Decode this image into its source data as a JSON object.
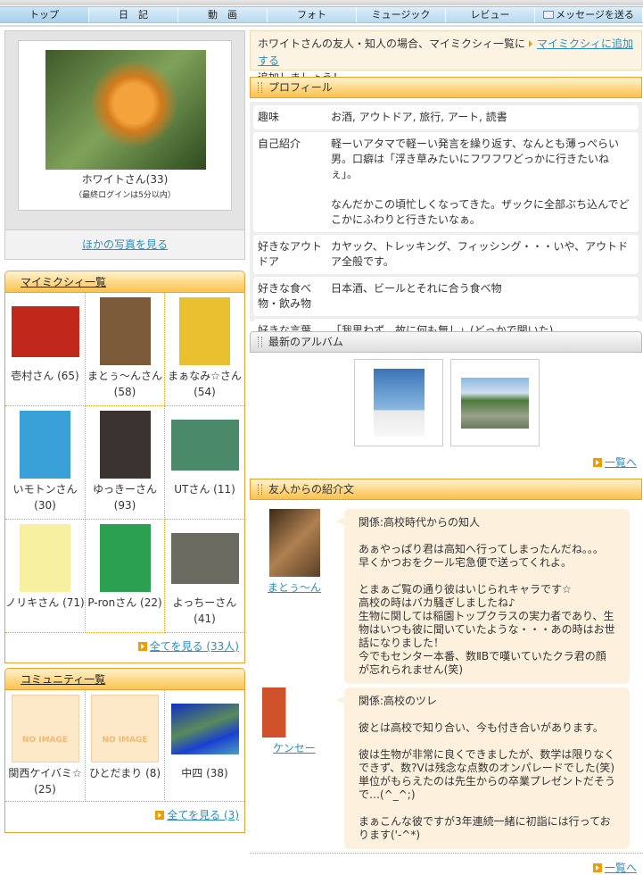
{
  "nav": {
    "items": [
      "トップ",
      "日　記",
      "動　画",
      "フォト",
      "ミュージック",
      "レビュー",
      "メッセージを送る"
    ]
  },
  "profile_card": {
    "name": "ホワイトさん(33)",
    "last_login": "（最終ログインは5分以内）",
    "other_photos": "ほかの写真を見る"
  },
  "mymixi": {
    "title": "マイミクシィ一覧",
    "friends": [
      {
        "name": "壱村さん (65)",
        "color": "#c0281c"
      },
      {
        "name": "まとぅ〜んさん (58)",
        "color": "#7a5a38"
      },
      {
        "name": "まぁなみ☆さん (54)",
        "color": "#e8c030"
      },
      {
        "name": "いモトンさん (30)",
        "color": "#3aa0d8"
      },
      {
        "name": "ゆっきーさん (93)",
        "color": "#3a3330"
      },
      {
        "name": "UTさん (11)",
        "color": "#4a8a6a"
      },
      {
        "name": "ノリキさん (71)",
        "color": "#f6f0a0"
      },
      {
        "name": "P-ronさん (22)",
        "color": "#2aa050"
      },
      {
        "name": "よっちーさん (41)",
        "color": "#6a6a60"
      }
    ],
    "see_all": "全てを見る (33人)"
  },
  "community": {
    "title": "コミュニティ一覧",
    "items": [
      {
        "name": "関西ケイバミ☆ (25)",
        "image": "NO IMAGE"
      },
      {
        "name": "ひとだまり (8)",
        "image": "NO IMAGE"
      },
      {
        "name": "中四 (38)",
        "image": ""
      }
    ],
    "see_all": "全てを見る (3)"
  },
  "notice": {
    "text": "ホワイトさんの友人・知人の場合、マイミクシィ一覧に",
    "link": "マイミクシィに追加する",
    "text2": "追加しましょう！"
  },
  "profile": {
    "title": "プロフィール",
    "rows": [
      {
        "key": "趣味",
        "value": "お酒, アウトドア, 旅行, アート, 読書"
      },
      {
        "key": "自己紹介",
        "value": "軽ーいアタマで軽ーい発言を繰り返す、なんとも薄っぺらい男。口癖は「浮き草みたいにフワフワどっかに行きたいねぇ」。\n\nなんだかこの頃忙しくなってきた。ザックに全部ぶち込んでどこかにふわりと行きたいなぁ。"
      },
      {
        "key": "好きなアウトドア",
        "value": "カヤック、トレッキング、フィッシング・・・いや、アウトドア全般です。"
      },
      {
        "key": "好きな食べ物・飲み物",
        "value": "日本酒、ビールとそれに合う食べ物"
      },
      {
        "key": "好きな言葉",
        "value": "「我思わず　故に何も無し」(どっかで聞いた)"
      }
    ]
  },
  "album": {
    "title": "最新のアルバム",
    "see_all": "一覧へ"
  },
  "testimonials": {
    "title": "友人からの紹介文",
    "see_all": "一覧へ",
    "items": [
      {
        "author": "まとぅ〜ん",
        "text": "関係:高校時代からの知人\n\nあぁやっぱり君は高知へ行ってしまったんだね。。。\n早くかつおをクール宅急便で送ってくれよ。\n\nとまぁご覧の通り彼はいじられキャラです☆\n高校の時はバカ騒ぎしましたね♪\n生物に関しては稲園トップクラスの実力者であり、生物はいつも彼に聞いていたような・・・あの時はお世話になりました！\n今でもセンター本番、数ⅡBで嘆いていたクラ君の顔が忘れられません(笑)"
      },
      {
        "author": "ケンセー",
        "text": "関係:高校のツレ\n\n彼とは高校で知り合い、今も付き合いがあります。\n\n彼は生物が非常に良くできましたが、数学は限りなくできず、数?Vは残念な点数のオンパレードでした(笑)\n単位がもらえたのは先生からの卒業プレゼントだそうで…(^_^;)\n\nまぁこんな彼ですが3年連続一緒に初詣には行っております('-^*)"
      }
    ]
  }
}
